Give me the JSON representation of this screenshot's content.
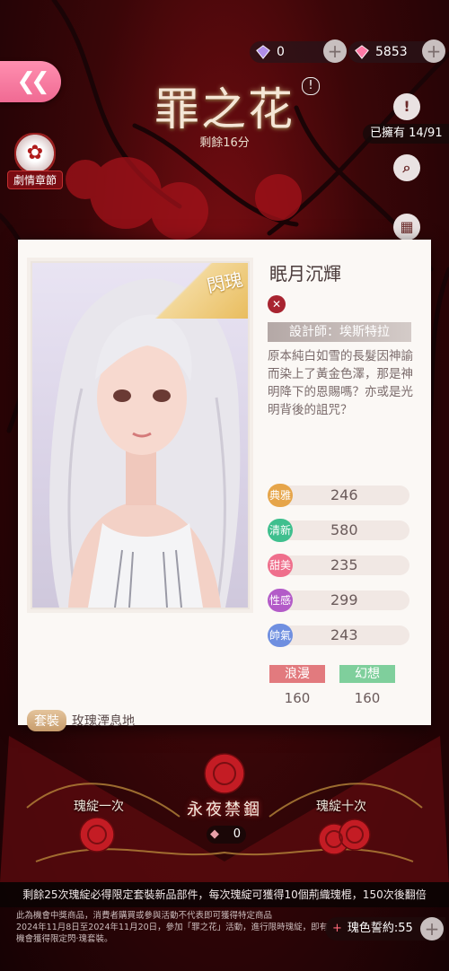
{
  "header": {
    "back_icon": "double-chevron-left-icon",
    "currency_diamond_purple": "0",
    "currency_diamond_pink": "5853",
    "title": "罪之花",
    "timer": "剩餘16分",
    "owned": "已擁有 14/91"
  },
  "side": {
    "chapter_label": "劇情章節"
  },
  "card": {
    "tag": "閃瑰",
    "name": "眠月沉輝",
    "designer": "設計師：埃斯特拉",
    "description": "原本純白如雪的長髮因神諭而染上了黃金色澤，那是神明降下的恩賜嗎？亦或是光明背後的詛咒？",
    "stats": [
      {
        "label": "典雅",
        "value": "246",
        "color": "#e6a54a"
      },
      {
        "label": "清新",
        "value": "580",
        "color": "#3fbf8e"
      },
      {
        "label": "甜美",
        "value": "235",
        "color": "#ef6f8c"
      },
      {
        "label": "性感",
        "value": "299",
        "color": "#b35bc8"
      },
      {
        "label": "帥氣",
        "value": "243",
        "color": "#6f8fe0"
      }
    ],
    "styles": [
      {
        "label": "浪漫",
        "value": "160",
        "color": "#e27a7e"
      },
      {
        "label": "幻想",
        "value": "160",
        "color": "#7fcf9c"
      }
    ],
    "set_tag": "套裝",
    "set_name": "玫瑰湮息地"
  },
  "bottom": {
    "draw_one": "瑰綻一次",
    "draw_ten": "瑰綻十次",
    "pool_name": "永夜禁錮",
    "ticket_count": "0",
    "notice": "剩餘25次瑰綻必得限定套裝新品部件，每次瑰綻可獲得10個荊織瑰棍，150次後翻倍",
    "fine1": "此為機會中獎商品，消費者購買或參與活動不代表即可獲得特定商品",
    "fine2": "2024年11月8日至2024年11月20日，參加「罪之花」活動，進行限時瑰綻，即有",
    "fine3": "機會獲得限定閃·瑰套裝。",
    "vow": "瑰色誓約:55"
  }
}
